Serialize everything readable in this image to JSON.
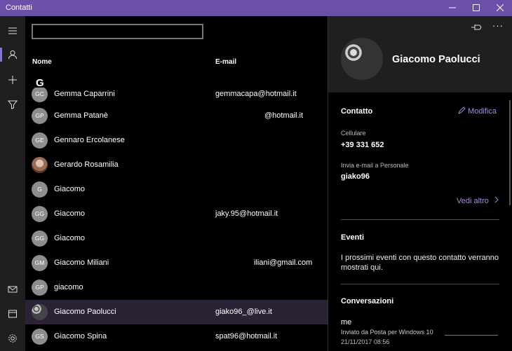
{
  "window": {
    "title": "Contatti"
  },
  "rail": {
    "icons": [
      "menu-icon",
      "contacts-icon",
      "add-icon",
      "filter-icon",
      "mail-icon",
      "calendar-icon",
      "settings-icon"
    ]
  },
  "list": {
    "search_value": "",
    "header_name": "Nome",
    "header_email": "E-mail",
    "group_letter": "G",
    "contacts": [
      {
        "initials": "GC",
        "name": "Gemma Caparrini",
        "email": "gemmacapa@hotmail.it"
      },
      {
        "initials": "GP",
        "name": "Gemma Patanè",
        "email": "@hotmail.it"
      },
      {
        "initials": "GE",
        "name": "Gennaro Ercolanese",
        "email": ""
      },
      {
        "initials": "",
        "name": "Gerardo Rosamilia",
        "email": ""
      },
      {
        "initials": "G",
        "name": "Giacomo",
        "email": ""
      },
      {
        "initials": "GG",
        "name": "Giacomo",
        "email": "jaky.95@hotmail.it"
      },
      {
        "initials": "GG",
        "name": "Giacomo",
        "email": ""
      },
      {
        "initials": "GM",
        "name": "Giacomo Miliani",
        "email": "iliani@gmail.com"
      },
      {
        "initials": "GP",
        "name": "giacomo",
        "email": ""
      },
      {
        "initials": "",
        "name": "Giacomo Paolucci",
        "email": "giako96_@live.it"
      },
      {
        "initials": "GS",
        "name": "Giacomo Spina",
        "email": "spat96@hotmail.it"
      }
    ]
  },
  "pane": {
    "name": "Giacomo Paolucci",
    "more_label": "···",
    "contact_title": "Contatto",
    "edit_label": "Modifica",
    "phone_label": "Cellulare",
    "phone_value": "+39 331 652",
    "email_label": "Invia e-mail a Personale",
    "email_value": "giako96",
    "see_all_label": "Vedi altro",
    "events_title": "Eventi",
    "events_text": "I prossimi eventi con questo contatto verranno mostrati qui.",
    "conversations_title": "Conversazioni",
    "conv_sender": "me",
    "conv_subject": "Inviato da Posta per Windows 10",
    "conv_date": "21/11/2017 08:56"
  },
  "colors": {
    "titlebar": "#6b4fa8",
    "accent": "#a78bdc",
    "selected_row": "#2b2235"
  }
}
